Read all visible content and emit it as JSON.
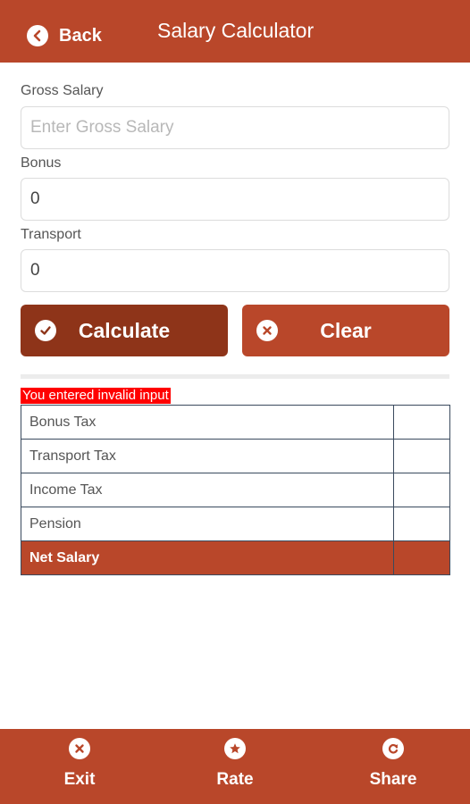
{
  "header": {
    "back_label": "Back",
    "title": "Salary Calculator"
  },
  "form": {
    "gross_salary": {
      "label": "Gross Salary",
      "value": "",
      "placeholder": "Enter Gross Salary"
    },
    "bonus": {
      "label": "Bonus",
      "value": "0"
    },
    "transport": {
      "label": "Transport",
      "value": "0"
    }
  },
  "actions": {
    "calculate_label": "Calculate",
    "clear_label": "Clear"
  },
  "error_message": "You entered invalid input",
  "results": {
    "rows": [
      {
        "label": "Bonus Tax",
        "value": ""
      },
      {
        "label": "Transport Tax",
        "value": ""
      },
      {
        "label": "Income Tax",
        "value": ""
      },
      {
        "label": "Pension",
        "value": ""
      },
      {
        "label": "Net Salary",
        "value": ""
      }
    ]
  },
  "bottom_nav": {
    "items": [
      {
        "label": "Exit",
        "icon": "close-icon"
      },
      {
        "label": "Rate",
        "icon": "star-icon"
      },
      {
        "label": "Share",
        "icon": "share-icon"
      }
    ]
  },
  "colors": {
    "primary": "#b9472a",
    "primary_dark": "#8e3419",
    "error": "#ff0000"
  }
}
